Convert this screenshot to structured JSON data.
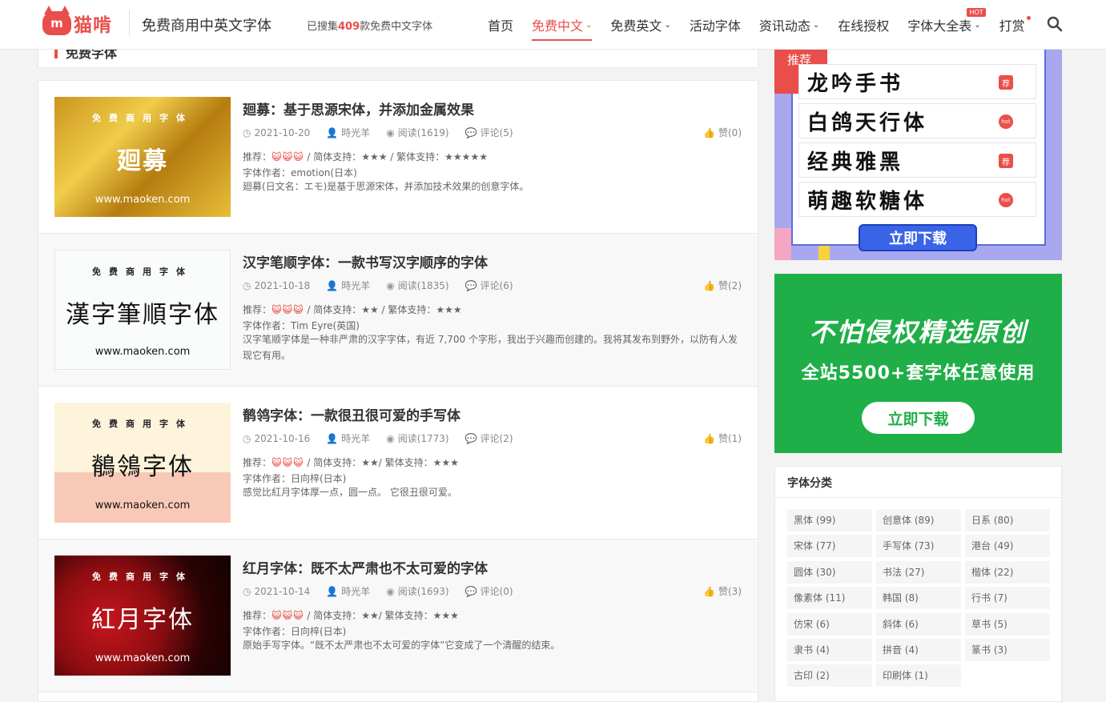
{
  "header": {
    "logo_icon_text": "m",
    "logo_text": "猫啃",
    "site_title": "免费商用中英文字体",
    "collect_prefix": "已搜集",
    "collect_count": "409",
    "collect_suffix": "款免费中文字体",
    "nav": [
      {
        "label": "首页",
        "caret": "",
        "badge": "",
        "active": false
      },
      {
        "label": "免费中文",
        "caret": "⌄",
        "badge": "",
        "active": true
      },
      {
        "label": "免费英文",
        "caret": "⌄",
        "badge": "",
        "active": false
      },
      {
        "label": "活动字体",
        "caret": "",
        "badge": "",
        "active": false
      },
      {
        "label": "资讯动态",
        "caret": "⌄",
        "badge": "",
        "active": false
      },
      {
        "label": "在线授权",
        "caret": "",
        "badge": "",
        "active": false
      },
      {
        "label": "字体大全表",
        "caret": "⌄",
        "badge": "HOT",
        "active": false
      },
      {
        "label": "打赏",
        "caret": "",
        "badge": "",
        "active": false
      }
    ]
  },
  "section": {
    "title": "免费字体"
  },
  "posts": [
    {
      "thumb_top": "免费商用字体",
      "thumb_main": "廻募",
      "thumb_url": "www.maoken.com",
      "title": "廻募：基于思源宋体，并添加金属效果",
      "date": "2021-10-20",
      "author": "時光羊",
      "views": "阅读(1619)",
      "comments": "评论(5)",
      "likes": "赞(0)",
      "rec_label": "推荐：",
      "rec_icons": "😺😺😺",
      "support": " / 简体支持：★★★ / 繁体支持：★★★★★",
      "font_author": "字体作者：emotion(日本)",
      "desc": "廻募(日文名：エモ)是基于思源宋体，并添加技术效果的创意字体。"
    },
    {
      "thumb_top": "免费商用字体",
      "thumb_main": "漢字筆順字体",
      "thumb_url": "www.maoken.com",
      "title": "汉字笔顺字体：一款书写汉字顺序的字体",
      "date": "2021-10-18",
      "author": "時光羊",
      "views": "阅读(1835)",
      "comments": "评论(6)",
      "likes": "赞(2)",
      "rec_label": "推荐：",
      "rec_icons": "😺😺😺",
      "support": " / 简体支持：★★ / 繁体支持：★★★",
      "font_author": "字体作者：Tim Eyre(英国)",
      "desc": "汉字笔顺字体是一种非严肃的汉字字体，有近 7,700 个字形，我出于兴趣而创建的。我将其发布到野外，以防有人发现它有用。"
    },
    {
      "thumb_top": "免费商用字体",
      "thumb_main": "鶺鴒字体",
      "thumb_url": "www.maoken.com",
      "title": "鹡鸰字体：一款很丑很可爱的手写体",
      "date": "2021-10-16",
      "author": "時光羊",
      "views": "阅读(1773)",
      "comments": "评论(2)",
      "likes": "赞(1)",
      "rec_label": "推荐：",
      "rec_icons": "😺😺😺",
      "support": " / 简体支持：★★/ 繁体支持：★★★",
      "font_author": "字体作者：日向梓(日本)",
      "desc": "感觉比紅月字体厚一点，圆一点。 它很丑很可爱。"
    },
    {
      "thumb_top": "免费商用字体",
      "thumb_main": "紅月字体",
      "thumb_url": "www.maoken.com",
      "title": "红月字体：既不太严肃也不太可爱的字体",
      "date": "2021-10-14",
      "author": "時光羊",
      "views": "阅读(1693)",
      "comments": "评论(0)",
      "likes": "赞(3)",
      "rec_label": "推荐：",
      "rec_icons": "😺😺😺",
      "support": " / 简体支持：★★/ 繁体支持：★★★",
      "font_author": "字体作者：日向梓(日本)",
      "desc": "原始手写字体。“既不太严肃也不太可爱的字体”它变成了一个清醒的结束。"
    }
  ],
  "sidebar": {
    "ad1": {
      "tag": "推荐",
      "fonts": [
        {
          "name": "龙吟手书",
          "badge": "荐"
        },
        {
          "name": "白鸽天行体",
          "badge": "hot"
        },
        {
          "name": "经典雅黑",
          "badge": "荐"
        },
        {
          "name": "萌趣软糖体",
          "badge": "hot"
        }
      ],
      "button": "立即下载"
    },
    "ad2": {
      "line1": "不怕侵权精选原创",
      "line2": "全站5500+套字体任意使用",
      "button": "立即下载"
    },
    "categories_title": "字体分类",
    "categories": [
      "黑体 (99)",
      "创意体 (89)",
      "日系 (80)",
      "宋体 (77)",
      "手写体 (73)",
      "港台 (49)",
      "圆体 (30)",
      "书法 (27)",
      "楷体 (22)",
      "像素体 (11)",
      "韩国 (8)",
      "行书 (7)",
      "仿宋 (6)",
      "斜体 (6)",
      "草书 (5)",
      "隶书 (4)",
      "拼音 (4)",
      "篆书 (3)",
      "古印 (2)",
      "印刷体 (1)"
    ]
  }
}
